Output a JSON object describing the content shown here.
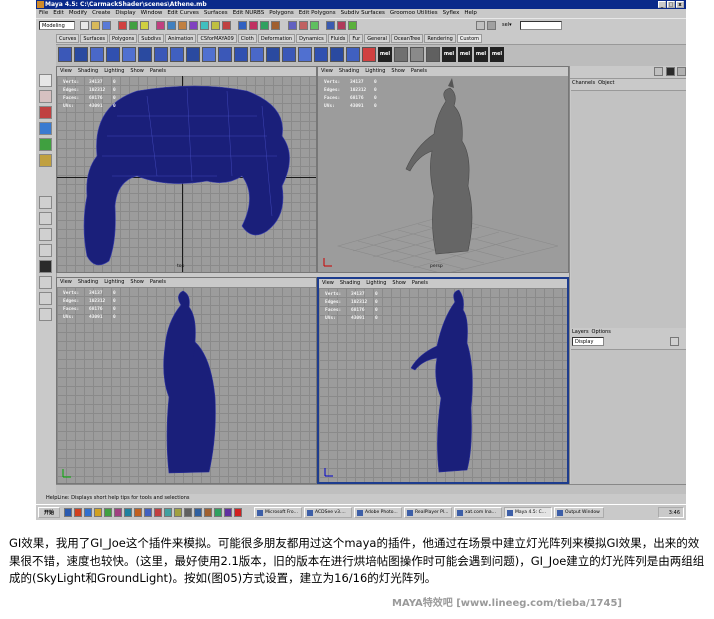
{
  "window": {
    "title": "Maya 4.5: C:\\CarmackShader\\scenes\\Athene.mb",
    "min": "_",
    "max": "□",
    "close": "x"
  },
  "menubar": [
    "File",
    "Edit",
    "Modify",
    "Create",
    "Display",
    "Window",
    "Edit Curves",
    "Surfaces",
    "Edit NURBS",
    "Polygons",
    "Edit Polygons",
    "Subdiv Surfaces",
    "Groomoo Utilities",
    "Syflex",
    "Help"
  ],
  "status_line": {
    "mode": "Modeling",
    "sel_label": "sel▾"
  },
  "shelf": {
    "tabs": [
      "Curves",
      "Surfaces",
      "Polygons",
      "Subdivs",
      "Animation",
      "CSforMAYA09",
      "Cloth",
      "Deformation",
      "Dynamics",
      "Fluids",
      "Fur",
      "General",
      "OceanTree",
      "Rendering",
      "Custom"
    ],
    "mel_buttons": [
      "mel",
      "mel",
      "mel",
      "mel",
      "mel"
    ]
  },
  "viewport_menu": [
    "View",
    "Shading",
    "Lighting",
    "Show",
    "Panels"
  ],
  "hud_labels": [
    "Verts:",
    "Edges:",
    "Faces:",
    "UVs:"
  ],
  "viewports": [
    {
      "id": "top",
      "stats": [
        "34137",
        "102312",
        "68176",
        "43091"
      ],
      "zeros": [
        "0",
        "0",
        "0",
        "0"
      ],
      "camera": "top",
      "active": false
    },
    {
      "id": "persp",
      "stats": [
        "34137",
        "102312",
        "68176",
        "43091"
      ],
      "zeros": [
        "0",
        "0",
        "0",
        "0"
      ],
      "camera": "persp",
      "active": false
    },
    {
      "id": "front",
      "stats": [
        "34137",
        "102312",
        "68176",
        "43091"
      ],
      "zeros": [
        "0",
        "0",
        "0",
        "0"
      ],
      "camera": "",
      "active": false
    },
    {
      "id": "side",
      "stats": [
        "34137",
        "102312",
        "68176",
        "43091"
      ],
      "zeros": [
        "0",
        "0",
        "0",
        "0"
      ],
      "camera": "",
      "active": true
    }
  ],
  "channel_box": {
    "tabs": [
      "Channels",
      "Object"
    ]
  },
  "layers": {
    "tabs": [
      "Layers",
      "Options"
    ],
    "dropdown": "Display"
  },
  "helpline": "HelpLine: Displays short help tips for tools and selections",
  "taskbar": {
    "start": "开始",
    "buttons": [
      "Microsoft Fro...",
      "ACDSee v3....",
      "Adobe Photo...",
      "RealPlayer Pl...",
      "xat.com Ina...",
      "Maya 4.5: C...",
      "Output Window"
    ],
    "clock": "3:46"
  },
  "caption": "GI效果，我用了GI_Joe这个插件来模拟。可能很多朋友都用过这个maya的插件，他通过在场景中建立灯光阵列来模拟GI效果，出来的效果很不错，速度也较快。(这里，最好使用2.1版本，旧的版本在进行烘培帖图操作时可能会遇到问题)，GI_Joe建立的灯光阵列是由两组组成的(SkyLight和GroundLight)。按如(图05)方式设置，建立为16/16的灯光阵列。",
  "watermark": "MAYA特效吧 [www.lineeg.com/tieba/1745]",
  "colors": {
    "mesh": "#1a1f7a",
    "titlebar": "#0a2a8a",
    "statue_gray": "#6a6a6a"
  }
}
